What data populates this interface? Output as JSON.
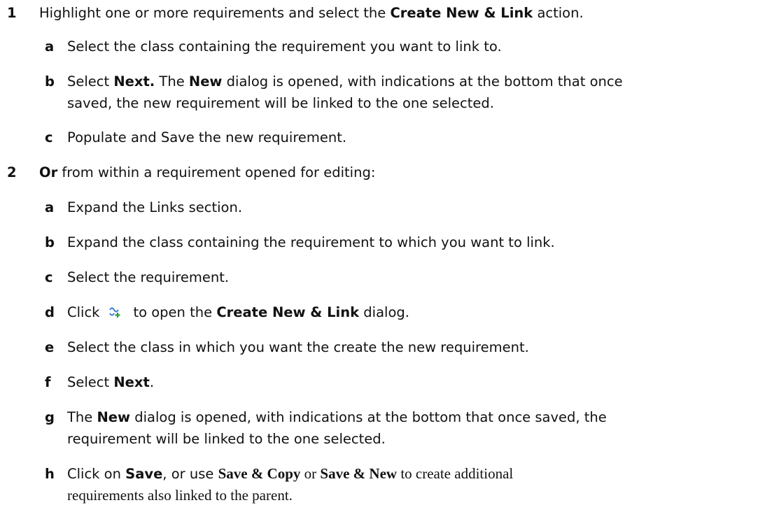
{
  "steps": [
    {
      "num": "1",
      "parts": [
        {
          "t": "Highlight one or more requirements and select the "
        },
        {
          "t": "Create New & Link",
          "b": true
        },
        {
          "t": " action."
        }
      ]
    },
    {
      "num": "2",
      "parts": [
        {
          "t": "Or",
          "b": true
        },
        {
          "t": " from within a requirement opened for editing:"
        }
      ]
    }
  ],
  "substeps1": [
    {
      "letter": "a",
      "lines": [
        [
          {
            "t": "Select the class containing the requirement you want to link to."
          }
        ]
      ]
    },
    {
      "letter": "b",
      "lines": [
        [
          {
            "t": "Select "
          },
          {
            "t": "Next.",
            "b": true
          },
          {
            "t": " The "
          },
          {
            "t": "New",
            "b": true
          },
          {
            "t": " dialog is opened, with indications at the bottom that once"
          }
        ],
        [
          {
            "t": "saved, the new requirement will be linked to the one selected."
          }
        ]
      ]
    },
    {
      "letter": "c",
      "lines": [
        [
          {
            "t": "Populate and Save the new requirement."
          }
        ]
      ]
    }
  ],
  "substeps2": [
    {
      "letter": "a",
      "lines": [
        [
          {
            "t": "Expand the Links section."
          }
        ]
      ]
    },
    {
      "letter": "b",
      "lines": [
        [
          {
            "t": "Expand the class containing the requirement to which you want to link."
          }
        ]
      ]
    },
    {
      "letter": "c",
      "lines": [
        [
          {
            "t": "Select the requirement."
          }
        ]
      ]
    },
    {
      "letter": "d",
      "lines": [
        [
          {
            "t": "Click"
          },
          {
            "icon": "create-new-link-icon"
          },
          {
            "t": "to open the "
          },
          {
            "t": "Create New & Link",
            "b": true
          },
          {
            "t": " dialog."
          }
        ]
      ]
    },
    {
      "letter": "e",
      "lines": [
        [
          {
            "t": "Select the class in which you want the create the new requirement."
          }
        ]
      ]
    },
    {
      "letter": "f",
      "lines": [
        [
          {
            "t": "Select "
          },
          {
            "t": "Next",
            "b": true
          },
          {
            "t": "."
          }
        ]
      ]
    },
    {
      "letter": "g",
      "lines": [
        [
          {
            "t": "The "
          },
          {
            "t": "New",
            "b": true
          },
          {
            "t": " dialog is opened, with indications at the bottom that once saved, the"
          }
        ],
        [
          {
            "t": "requirement will be linked to the one selected."
          }
        ]
      ]
    },
    {
      "letter": "h",
      "lines": [
        [
          {
            "t": "Click on "
          },
          {
            "t": "Save",
            "b": true
          },
          {
            "t": ", or use "
          },
          {
            "t": "Save & Copy",
            "b": true,
            "serif": true
          },
          {
            "t": " or ",
            "serif": true
          },
          {
            "t": "Save & New",
            "b": true,
            "serif": true
          },
          {
            "t": " to create additional",
            "serif": true
          }
        ],
        [
          {
            "t": "requirements also linked to the parent.",
            "serif": true
          }
        ]
      ]
    }
  ],
  "colors": {
    "text": "#111111",
    "icon_primary": "#3b7dd8",
    "icon_accent": "#2a9d3c"
  }
}
